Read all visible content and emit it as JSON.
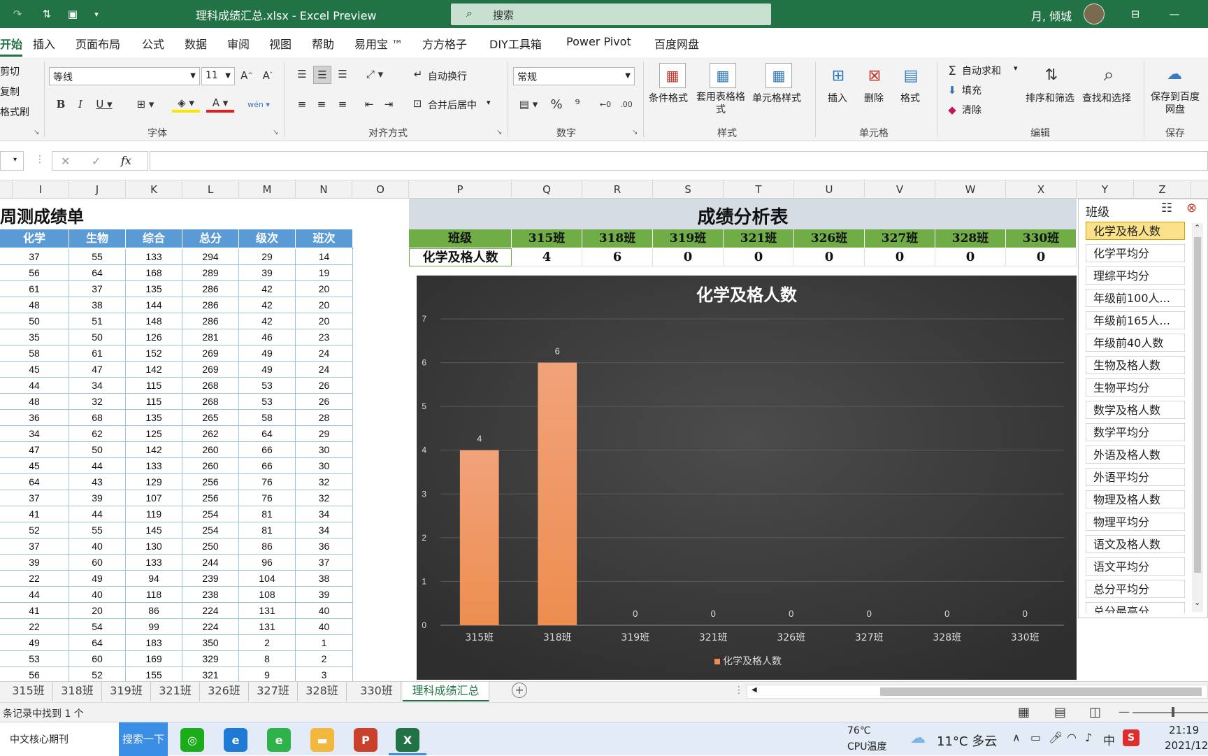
{
  "window": {
    "file_title": "理科成绩汇总.xlsx  -  Excel Preview",
    "search_placeholder": "搜索",
    "user_name": "月, 倾城"
  },
  "menu": [
    "开始",
    "插入",
    "页面布局",
    "公式",
    "数据",
    "审阅",
    "视图",
    "帮助",
    "易用宝 ™",
    "方方格子",
    "DIY工具箱",
    "Power Pivot",
    "百度网盘"
  ],
  "ribbon": {
    "clipboard": {
      "cut": "剪切",
      "copy": "复制",
      "format_painter": "格式刷"
    },
    "font": {
      "name": "等线",
      "size": "11",
      "group": "字体"
    },
    "alignment": {
      "wrap": "自动换行",
      "merge": "合并后居中",
      "group": "对齐方式"
    },
    "number": {
      "format": "常规",
      "group": "数字"
    },
    "styles": {
      "conditional": "条件格式",
      "table": "套用表格格式",
      "cell": "单元格样式",
      "group": "样式"
    },
    "cells": {
      "insert": "插入",
      "delete": "删除",
      "format": "格式",
      "group": "单元格"
    },
    "editing": {
      "autosum": "自动求和",
      "fill": "填充",
      "clear": "清除",
      "sort": "排序和筛选",
      "find": "查找和选择",
      "group": "编辑"
    },
    "save": {
      "label": "保存到百度网盘",
      "group": "保存"
    }
  },
  "formula": {
    "fx": "fx",
    "value": ""
  },
  "columns": [
    "I",
    "J",
    "K",
    "L",
    "M",
    "N",
    "O",
    "P",
    "Q",
    "R",
    "S",
    "T",
    "U",
    "V",
    "W",
    "X",
    "Y",
    "Z"
  ],
  "left_table": {
    "title": "周测成绩单",
    "headers": [
      "化学",
      "生物",
      "综合",
      "总分",
      "级次",
      "班次"
    ],
    "rows": [
      [
        "37",
        "55",
        "133",
        "294",
        "29",
        "14"
      ],
      [
        "56",
        "64",
        "168",
        "289",
        "39",
        "19"
      ],
      [
        "61",
        "37",
        "135",
        "286",
        "42",
        "20"
      ],
      [
        "48",
        "38",
        "144",
        "286",
        "42",
        "20"
      ],
      [
        "50",
        "51",
        "148",
        "286",
        "42",
        "20"
      ],
      [
        "35",
        "50",
        "126",
        "281",
        "46",
        "23"
      ],
      [
        "58",
        "61",
        "152",
        "269",
        "49",
        "24"
      ],
      [
        "45",
        "47",
        "142",
        "269",
        "49",
        "24"
      ],
      [
        "44",
        "34",
        "115",
        "268",
        "53",
        "26"
      ],
      [
        "48",
        "32",
        "115",
        "268",
        "53",
        "26"
      ],
      [
        "36",
        "68",
        "135",
        "265",
        "58",
        "28"
      ],
      [
        "34",
        "62",
        "125",
        "262",
        "64",
        "29"
      ],
      [
        "47",
        "50",
        "142",
        "260",
        "66",
        "30"
      ],
      [
        "45",
        "44",
        "133",
        "260",
        "66",
        "30"
      ],
      [
        "64",
        "43",
        "129",
        "256",
        "76",
        "32"
      ],
      [
        "37",
        "39",
        "107",
        "256",
        "76",
        "32"
      ],
      [
        "41",
        "44",
        "119",
        "254",
        "81",
        "34"
      ],
      [
        "52",
        "55",
        "145",
        "254",
        "81",
        "34"
      ],
      [
        "37",
        "40",
        "130",
        "250",
        "86",
        "36"
      ],
      [
        "39",
        "60",
        "133",
        "244",
        "96",
        "37"
      ],
      [
        "22",
        "49",
        "94",
        "239",
        "104",
        "38"
      ],
      [
        "44",
        "40",
        "118",
        "238",
        "108",
        "39"
      ],
      [
        "41",
        "20",
        "86",
        "224",
        "131",
        "40"
      ],
      [
        "22",
        "54",
        "99",
        "224",
        "131",
        "40"
      ],
      [
        "49",
        "64",
        "183",
        "350",
        "2",
        "1"
      ],
      [
        "53",
        "60",
        "169",
        "329",
        "8",
        "2"
      ],
      [
        "56",
        "52",
        "155",
        "321",
        "9",
        "3"
      ]
    ]
  },
  "analysis": {
    "title": "成绩分析表",
    "header_label": "班级",
    "row_label": "化学及格人数",
    "classes": [
      "315班",
      "318班",
      "319班",
      "321班",
      "326班",
      "327班",
      "328班",
      "330班"
    ],
    "values": [
      "4",
      "6",
      "0",
      "0",
      "0",
      "0",
      "0",
      "0"
    ]
  },
  "chart_data": {
    "type": "bar",
    "title": "化学及格人数",
    "categories": [
      "315班",
      "318班",
      "319班",
      "321班",
      "326班",
      "327班",
      "328班",
      "330班"
    ],
    "series": [
      {
        "name": "化学及格人数",
        "values": [
          4,
          6,
          0,
          0,
          0,
          0,
          0,
          0
        ]
      }
    ],
    "data_labels": [
      "4",
      "6",
      "0",
      "0",
      "0",
      "0",
      "0",
      "0"
    ],
    "ylim": [
      0,
      7
    ],
    "yticks": [
      "0",
      "1",
      "2",
      "3",
      "4",
      "5",
      "6",
      "7"
    ],
    "xlabel": "",
    "ylabel": "",
    "legend": "bottom",
    "colors": {
      "bar": "#ed8e50",
      "background": "#404040"
    }
  },
  "slicer": {
    "title": "班级",
    "items": [
      "化学及格人数",
      "化学平均分",
      "理综平均分",
      "年级前100人...",
      "年级前165人...",
      "年级前40人数",
      "生物及格人数",
      "生物平均分",
      "数学及格人数",
      "数学平均分",
      "外语及格人数",
      "外语平均分",
      "物理及格人数",
      "物理平均分",
      "语文及格人数",
      "语文平均分",
      "总分平均分",
      "总分最高分"
    ],
    "selected": 0
  },
  "sheets": [
    "315班",
    "318班",
    "319班",
    "321班",
    "326班",
    "327班",
    "328班",
    "330班",
    "理科成绩汇总"
  ],
  "active_sheet": 8,
  "status": {
    "text": "条记录中找到 1 个"
  },
  "taskbar": {
    "search_text": "中文核心期刊",
    "search_button": "搜索一下",
    "cpu_temp": "76℃",
    "cpu_label": "CPU温度",
    "weather": "11°C  多云",
    "ime": "中",
    "time": "21:19",
    "date": "2021/12"
  },
  "colors": {
    "excel_green": "#217346",
    "header_blue": "#5b9bd5",
    "header_green": "#70ad47",
    "chart_bg": "#404040",
    "slicer_selected": "#fbe28a"
  }
}
